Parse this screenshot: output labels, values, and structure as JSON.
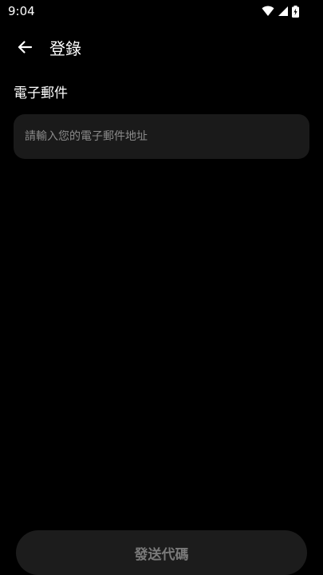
{
  "status_bar": {
    "time": "9:04",
    "icons": [
      "wifi-icon",
      "signal-icon",
      "battery-charging-icon"
    ]
  },
  "app_bar": {
    "back_icon": "arrow-left-icon",
    "title": "登錄"
  },
  "form": {
    "email_label": "電子郵件",
    "email_placeholder": "請輸入您的電子郵件地址",
    "email_value": ""
  },
  "actions": {
    "send_code_label": "發送代碼"
  },
  "colors": {
    "background": "#000000",
    "field_background": "#1a1a1a",
    "placeholder_text": "#8a8a8a",
    "button_background": "#1c1c1c",
    "button_text_disabled": "#7a7a7a"
  }
}
